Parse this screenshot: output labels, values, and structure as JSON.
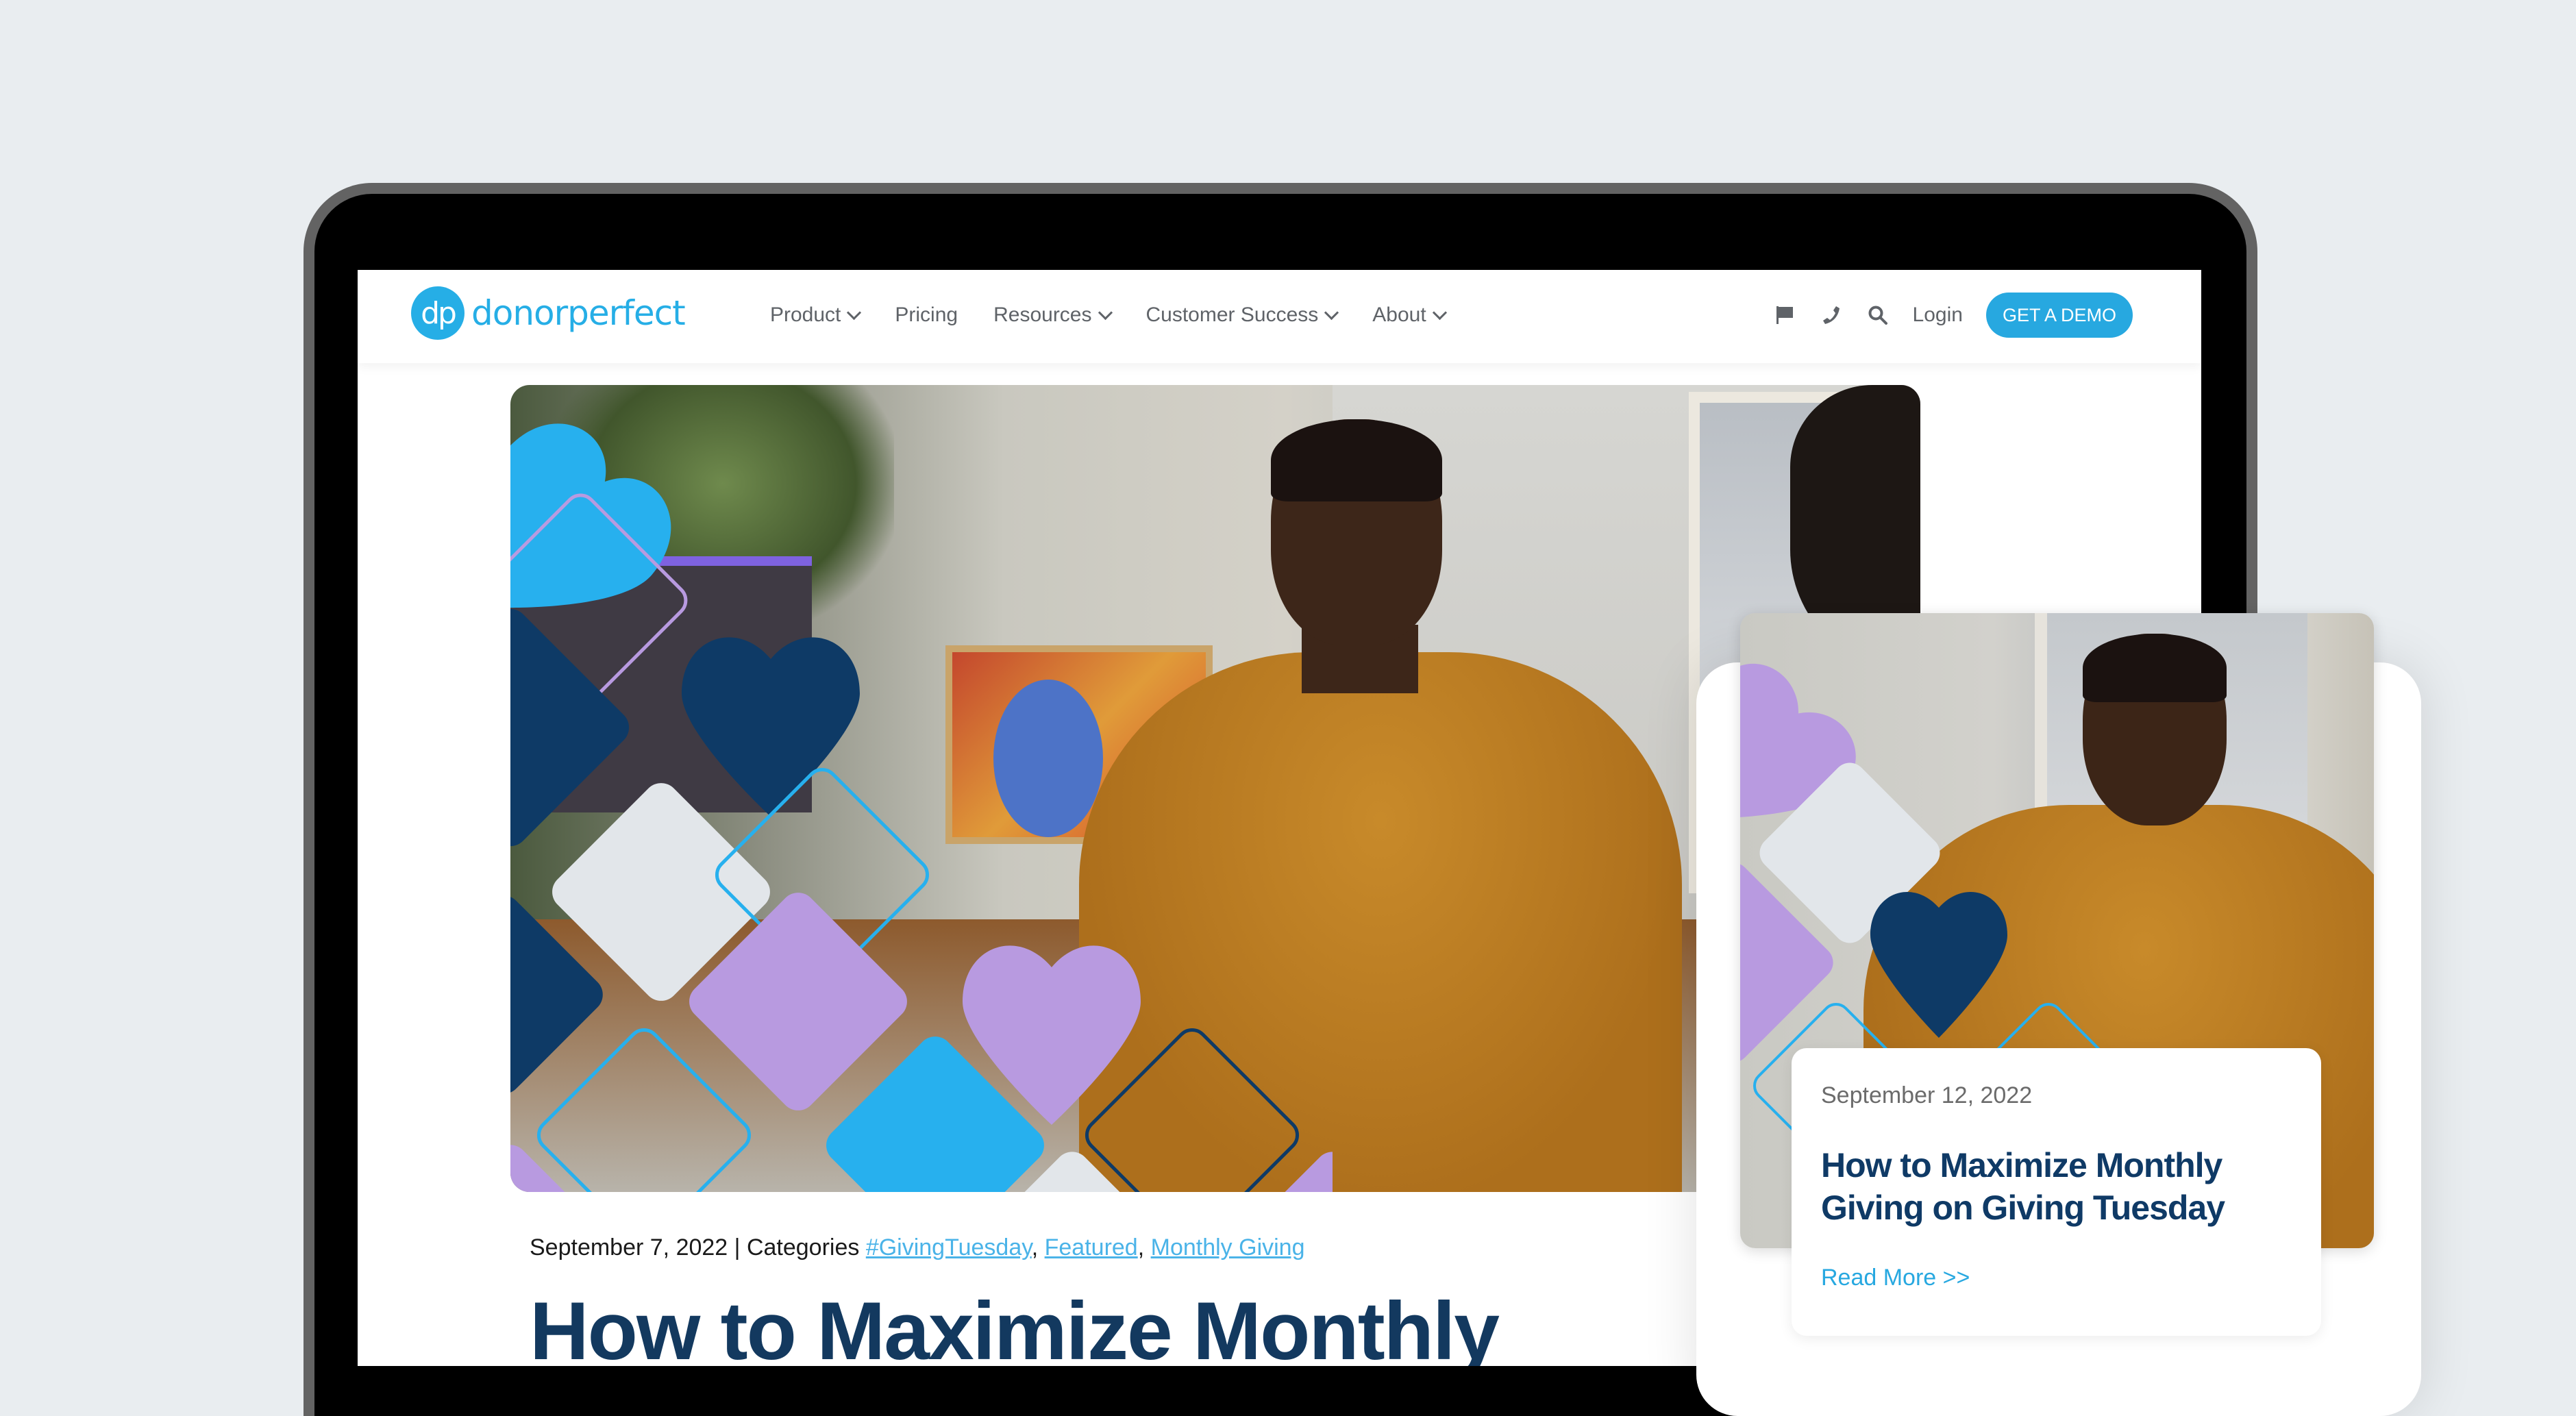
{
  "site": {
    "logo_mark": "dp",
    "logo_text": "donorperfect"
  },
  "nav": {
    "items": [
      {
        "label": "Product",
        "has_dropdown": true
      },
      {
        "label": "Pricing",
        "has_dropdown": false
      },
      {
        "label": "Resources",
        "has_dropdown": true
      },
      {
        "label": "Customer Success",
        "has_dropdown": true
      },
      {
        "label": "About",
        "has_dropdown": true
      }
    ],
    "icons": [
      "flag-icon",
      "phone-icon",
      "search-icon"
    ],
    "login_label": "Login",
    "demo_label": "GET A DEMO"
  },
  "article": {
    "date": "September 7, 2022",
    "separator": " | ",
    "categories_label": "Categories",
    "categories": [
      "#GivingTuesday",
      "Featured",
      "Monthly Giving"
    ],
    "title": "How to Maximize Monthly"
  },
  "mobile_card": {
    "date": "September 12, 2022",
    "title": "How to Maximize Monthly Giving on Giving Tuesday",
    "link": "Read More >>"
  },
  "colors": {
    "brand_blue": "#27a8e0",
    "navy": "#0f3a66",
    "purple": "#b89ae0",
    "light_gray": "#e2e6ea",
    "background": "#e9edf0"
  }
}
